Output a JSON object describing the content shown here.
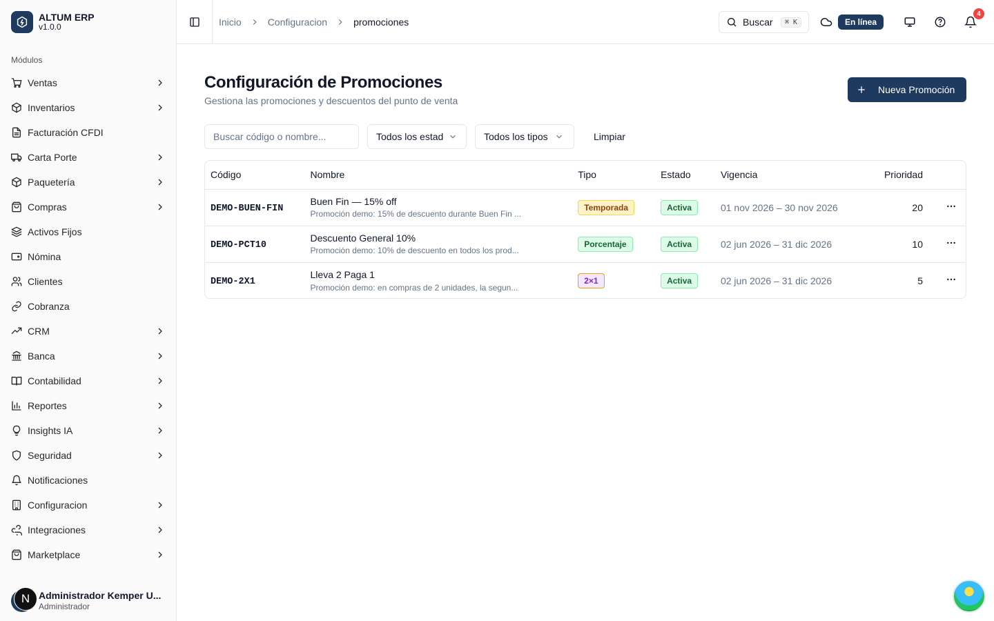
{
  "brand": {
    "name": "ALTUM ERP",
    "version": "v1.0.0"
  },
  "sidebar": {
    "section_label": "Módulos",
    "items": [
      {
        "label": "Ventas",
        "icon": "cart-icon",
        "expandable": true
      },
      {
        "label": "Inventarios",
        "icon": "package-icon",
        "expandable": true
      },
      {
        "label": "Facturación CFDI",
        "icon": "file-icon",
        "expandable": false
      },
      {
        "label": "Carta Porte",
        "icon": "truck-icon",
        "expandable": true
      },
      {
        "label": "Paquetería",
        "icon": "package-icon",
        "expandable": true
      },
      {
        "label": "Compras",
        "icon": "shopping-bag-icon",
        "expandable": true
      },
      {
        "label": "Activos Fijos",
        "icon": "layers-icon",
        "expandable": false
      },
      {
        "label": "Nómina",
        "icon": "wallet-icon",
        "expandable": false
      },
      {
        "label": "Clientes",
        "icon": "users-icon",
        "expandable": false
      },
      {
        "label": "Cobranza",
        "icon": "link-icon",
        "expandable": false
      },
      {
        "label": "CRM",
        "icon": "trending-icon",
        "expandable": true
      },
      {
        "label": "Banca",
        "icon": "bank-icon",
        "expandable": true
      },
      {
        "label": "Contabilidad",
        "icon": "book-icon",
        "expandable": true
      },
      {
        "label": "Reportes",
        "icon": "bar-chart-icon",
        "expandable": true
      },
      {
        "label": "Insights IA",
        "icon": "lightbulb-icon",
        "expandable": true
      },
      {
        "label": "Seguridad",
        "icon": "shield-icon",
        "expandable": true
      },
      {
        "label": "Notificaciones",
        "icon": "bell-icon",
        "expandable": false
      },
      {
        "label": "Configuracion",
        "icon": "building-icon",
        "expandable": true
      },
      {
        "label": "Integraciones",
        "icon": "webhook-icon",
        "expandable": true
      },
      {
        "label": "Marketplace",
        "icon": "shopping-bag-icon",
        "expandable": true
      }
    ]
  },
  "user": {
    "initial": "N",
    "name": "Administrador Kemper U...",
    "role": "Administrador"
  },
  "header": {
    "breadcrumbs": [
      "Inicio",
      "Configuracion",
      "promociones"
    ],
    "search_label": "Buscar",
    "search_shortcut": "⌘ K",
    "status": "En línea",
    "notification_count": "4"
  },
  "main": {
    "title": "Configuración de Promociones",
    "subtitle": "Gestiona las promociones y descuentos del punto de venta",
    "new_button": "Nueva Promoción",
    "filters": {
      "search_placeholder": "Buscar código o nombre...",
      "status_select": "Todos los estados",
      "type_select": "Todos los tipos",
      "clear": "Limpiar"
    },
    "table": {
      "columns": [
        "Código",
        "Nombre",
        "Tipo",
        "Estado",
        "Vigencia",
        "Prioridad"
      ],
      "rows": [
        {
          "code": "DEMO-BUEN-FIN",
          "name": "Buen Fin — 15% off",
          "desc": "Promoción demo: 15% de descuento durante Buen Fin ...",
          "type": "Temporada",
          "status": "Activa",
          "validity": "01 nov 2026 – 30 nov 2026",
          "priority": "20"
        },
        {
          "code": "DEMO-PCT10",
          "name": "Descuento General 10%",
          "desc": "Promoción demo: 10% de descuento en todos los prod...",
          "type": "Porcentaje",
          "status": "Activa",
          "validity": "02 jun 2026 – 31 dic 2026",
          "priority": "10"
        },
        {
          "code": "DEMO-2X1",
          "name": "Lleva 2 Paga 1",
          "desc": "Promoción demo: en compras de 2 unidades, la segun...",
          "type": "2×1",
          "status": "Activa",
          "validity": "02 jun 2026 – 31 dic 2026",
          "priority": "5"
        }
      ]
    }
  },
  "colors": {
    "brand": "#1e3a5f",
    "danger": "#ef4444"
  }
}
